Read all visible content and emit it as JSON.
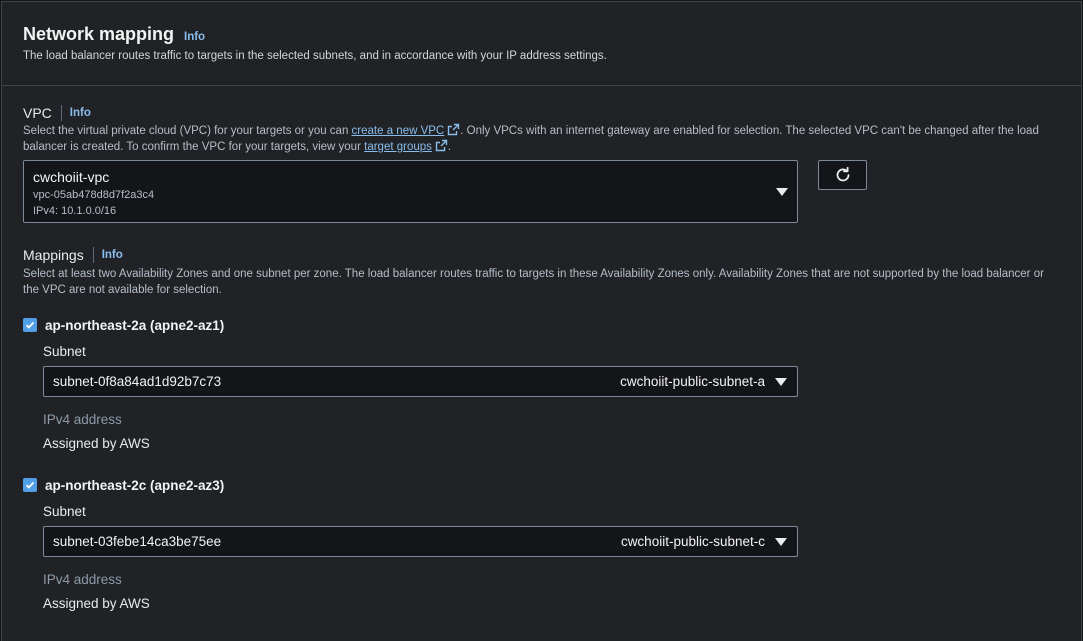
{
  "header": {
    "title": "Network mapping",
    "info": "Info",
    "description": "The load balancer routes traffic to targets in the selected subnets, and in accordance with your IP address settings."
  },
  "vpc": {
    "label": "VPC",
    "info": "Info",
    "desc_part1": "Select the virtual private cloud (VPC) for your targets or you can",
    "create_link": "create a new VPC",
    "desc_part2": ". Only VPCs with an internet gateway are enabled for selection. The selected VPC can't be changed after the load balancer is created. To confirm the VPC for your targets, view your",
    "target_groups_link": "target groups",
    "desc_part3": ".",
    "selected": {
      "name": "cwchoiit-vpc",
      "id": "vpc-05ab478d8d7f2a3c4",
      "cidr": "IPv4: 10.1.0.0/16"
    },
    "refresh_icon": "refresh-icon"
  },
  "mappings": {
    "label": "Mappings",
    "info": "Info",
    "description": "Select at least two Availability Zones and one subnet per zone. The load balancer routes traffic to targets in these Availability Zones only. Availability Zones that are not supported by the load balancer or the VPC are not available for selection.",
    "zones": [
      {
        "name": "ap-northeast-2a (apne2-az1)",
        "checked": true,
        "subnet_label": "Subnet",
        "subnet_id": "subnet-0f8a84ad1d92b7c73",
        "subnet_name": "cwchoiit-public-subnet-a",
        "ipv4_label": "IPv4 address",
        "ipv4_value": "Assigned by AWS"
      },
      {
        "name": "ap-northeast-2c (apne2-az3)",
        "checked": true,
        "subnet_label": "Subnet",
        "subnet_id": "subnet-03febe14ca3be75ee",
        "subnet_name": "cwchoiit-public-subnet-c",
        "ipv4_label": "IPv4 address",
        "ipv4_value": "Assigned by AWS"
      }
    ]
  },
  "colors": {
    "background": "#202225",
    "link": "#89bdee",
    "checkbox": "#539fe5"
  }
}
